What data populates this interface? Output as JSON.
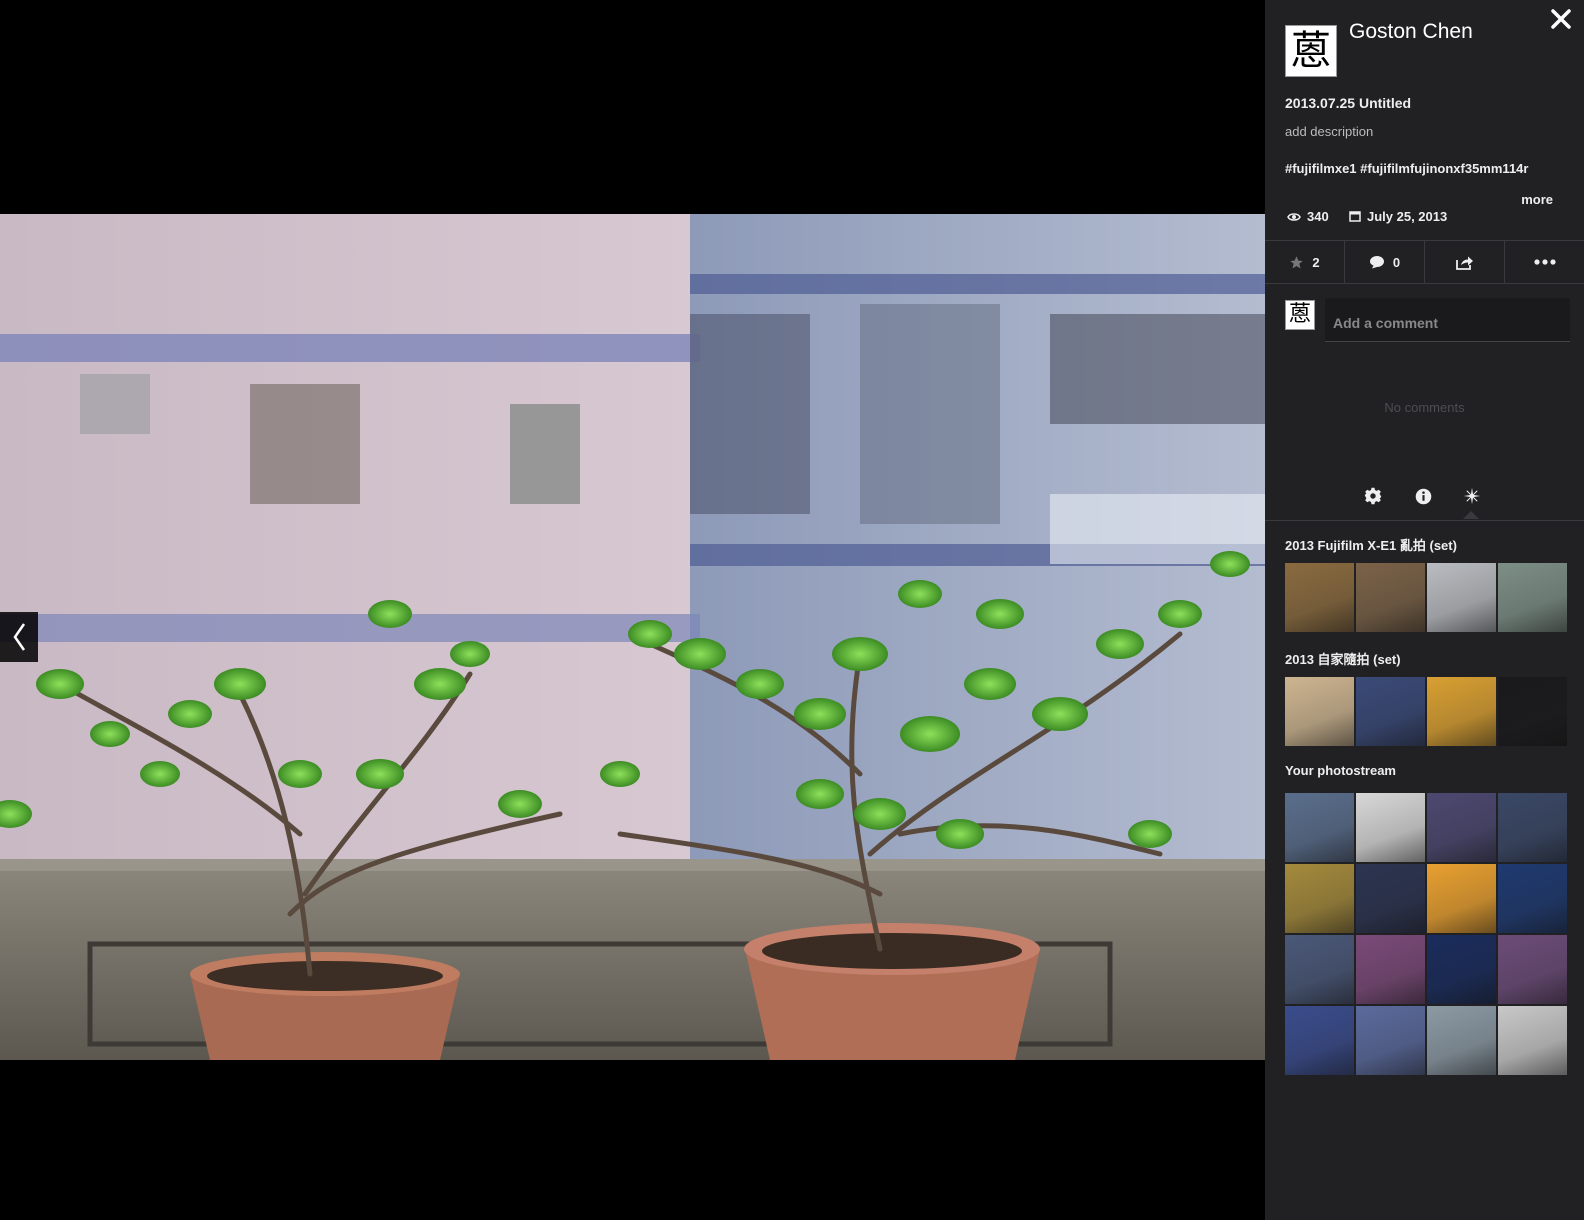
{
  "viewer": {
    "prev_label": "‹"
  },
  "panel": {
    "close_icon": "close-icon",
    "avatar_glyph": "蒽",
    "author": "Goston Chen",
    "title": "2013.07.25 Untitled",
    "description_placeholder": "add description",
    "tags": "#fujifilmxe1 #fujifilmfujinonxf35mm114r",
    "more_label": "more",
    "views": "340",
    "date": "July 25, 2013"
  },
  "actions": {
    "favorites_count": "2",
    "comments_count": "0"
  },
  "comments": {
    "placeholder": "Add a comment",
    "empty_text": "No comments"
  },
  "sets": [
    {
      "title": "2013 Fujifilm X-E1 亂拍 (set)",
      "thumb_colors": [
        "#8a6b3f",
        "#7a6247",
        "#b9bcc0",
        "#7d8f86"
      ]
    },
    {
      "title": "2013 自家隨拍 (set)",
      "thumb_colors": [
        "#cdb590",
        "#3a4a78",
        "#d9a032",
        "#1a1a1c"
      ]
    }
  ],
  "photostream": {
    "title": "Your photostream",
    "thumb_colors": [
      "#5a6e8c",
      "#d8d8d8",
      "#4c4870",
      "#3a4866",
      "#a48a3c",
      "#2c3450",
      "#e8a030",
      "#1f3a70",
      "#4a5878",
      "#7a4a78",
      "#1a2c5c",
      "#6c4c78",
      "#3a4c8c",
      "#5a6a9c",
      "#8c9aa4",
      "#c8c8c8"
    ]
  },
  "colors": {
    "panel_bg": "#212124",
    "accent_text": "#eeeeee",
    "muted_text": "#4d4d52"
  }
}
